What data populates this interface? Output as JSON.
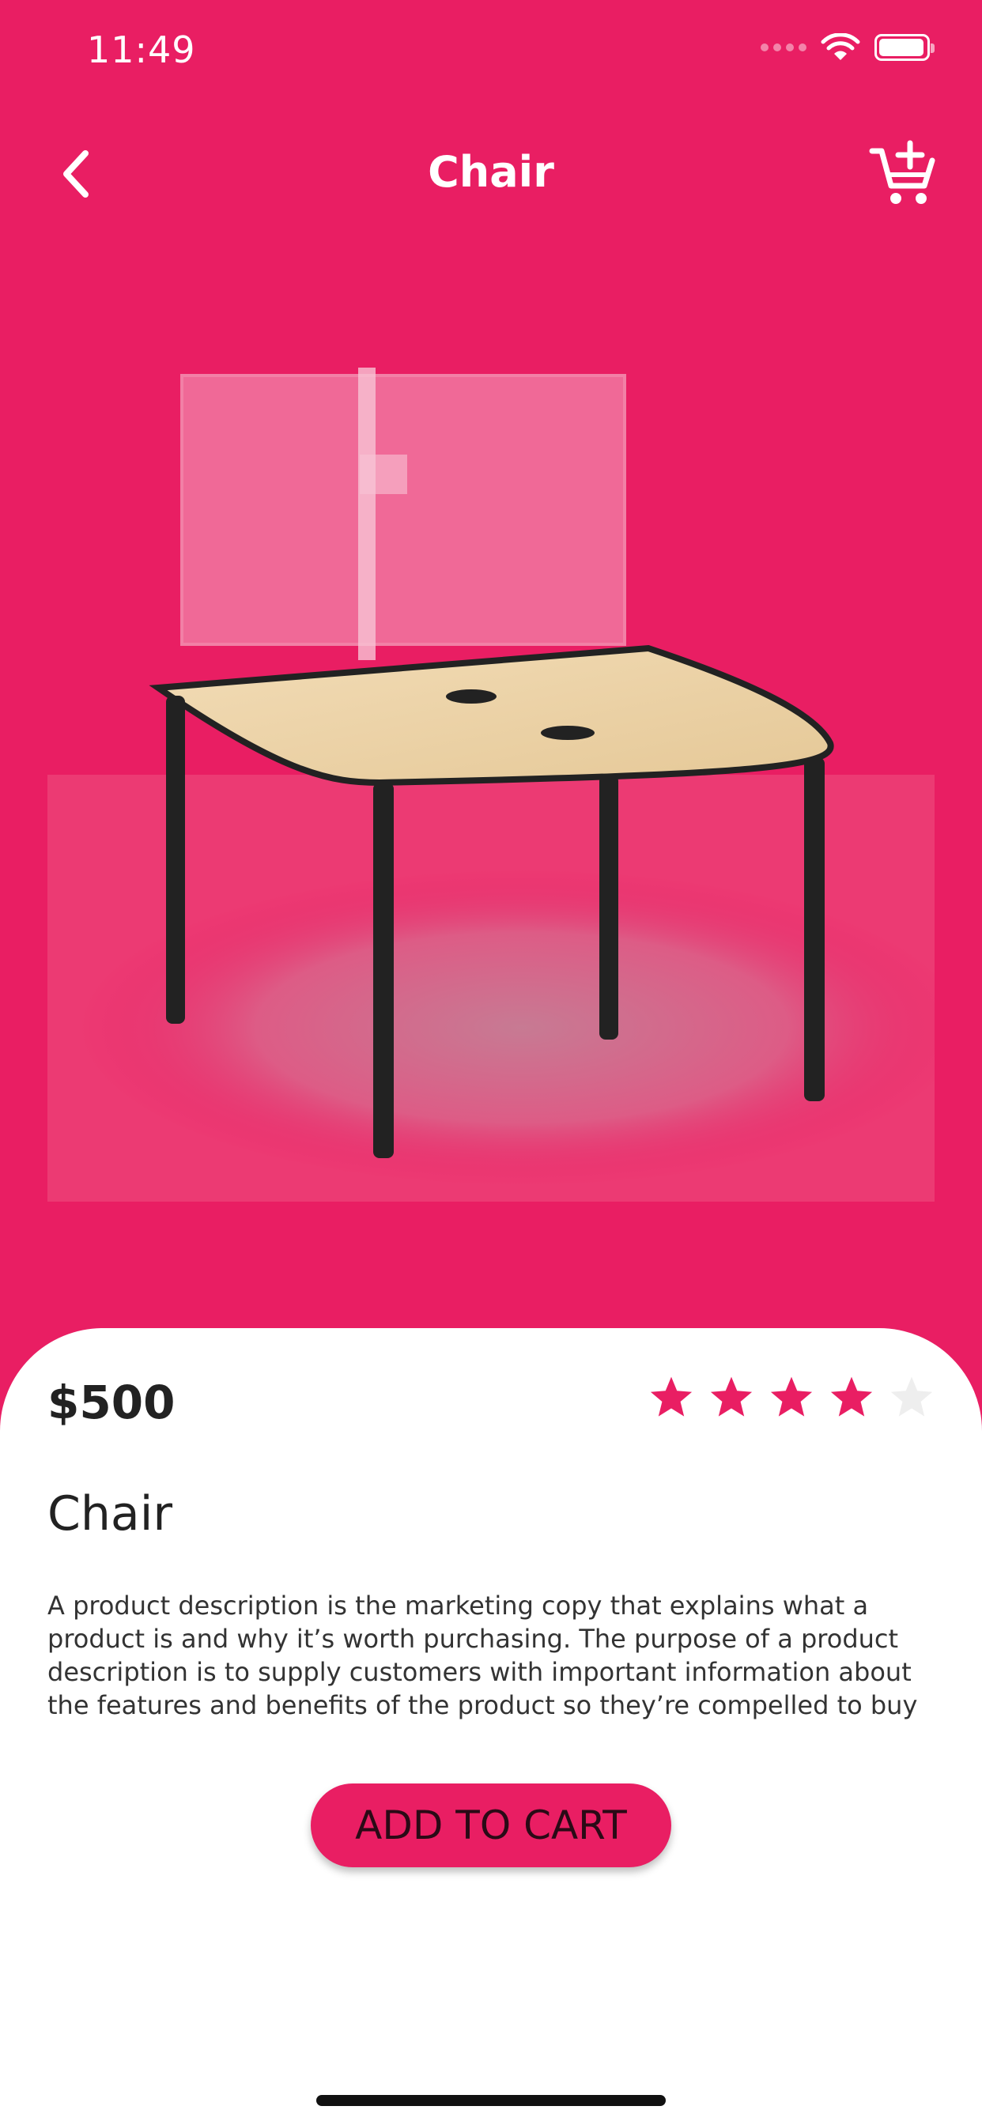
{
  "status_bar": {
    "time": "11:49"
  },
  "nav": {
    "title": "Chair"
  },
  "product": {
    "price": "$500",
    "name": "Chair",
    "rating": 4,
    "rating_max": 5,
    "description": "A product description is the marketing copy that explains what a product is and why it’s worth purchasing. The purpose of a product description is to supply customers with important information about the features and benefits of the product so they’re compelled to buy"
  },
  "actions": {
    "add_to_cart_label": "ADD TO CART"
  },
  "colors": {
    "accent": "#e91e63",
    "star_empty": "#eeeeee",
    "text_dark": "#222222"
  },
  "icons": {
    "back": "chevron-left-icon",
    "add_cart": "cart-plus-icon"
  }
}
